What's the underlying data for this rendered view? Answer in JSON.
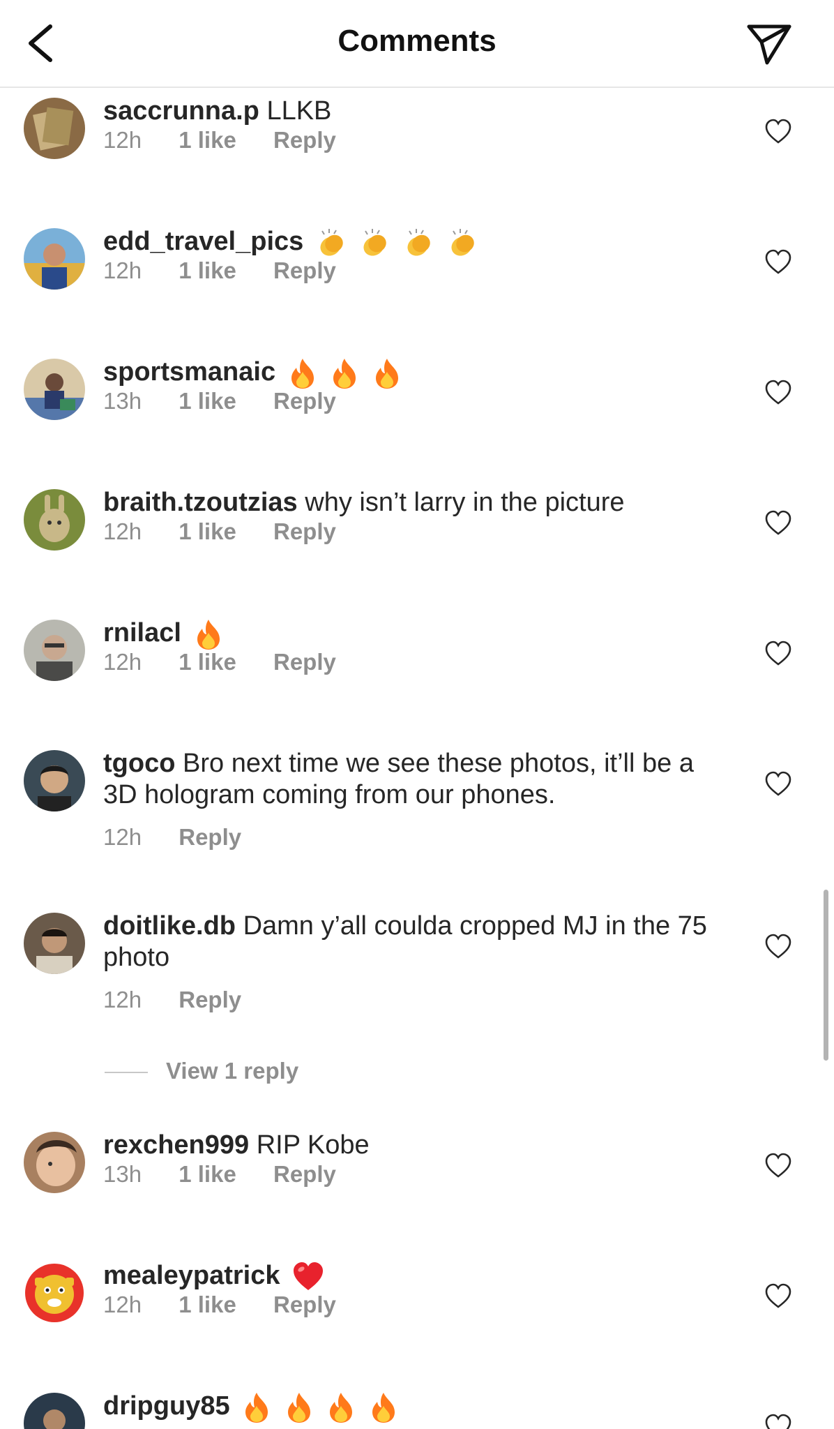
{
  "header": {
    "title": "Comments",
    "back_icon": "chevron-left-icon",
    "send_icon": "paper-plane-icon"
  },
  "comments": [
    {
      "username": "saccrunna.p",
      "text": "LLKB",
      "time": "12h",
      "likes": "1 like",
      "reply": "Reply",
      "emoji": "",
      "emoji_count": 0,
      "avatar_color": "#8a6a45"
    },
    {
      "username": "edd_travel_pics",
      "text": "",
      "time": "12h",
      "likes": "1 like",
      "reply": "Reply",
      "emoji": "clap",
      "emoji_count": 4,
      "avatar_color": "#e0b040"
    },
    {
      "username": "sportsmanaic",
      "text": "",
      "time": "13h",
      "likes": "1 like",
      "reply": "Reply",
      "emoji": "fire",
      "emoji_count": 3,
      "avatar_color": "#5577aa"
    },
    {
      "username": "braith.tzoutzias",
      "text": "why isn’t larry in the picture",
      "time": "12h",
      "likes": "1 like",
      "reply": "Reply",
      "emoji": "",
      "emoji_count": 0,
      "avatar_color": "#7a8c3c"
    },
    {
      "username": "rnilacl",
      "text": "",
      "time": "12h",
      "likes": "1 like",
      "reply": "Reply",
      "emoji": "fire",
      "emoji_count": 1,
      "avatar_color": "#8a8a80"
    },
    {
      "username": "tgoco",
      "text": "Bro next time we see these photos, it’ll be a 3D hologram coming from our phones.",
      "time": "12h",
      "likes": "",
      "reply": "Reply",
      "emoji": "",
      "emoji_count": 0,
      "avatar_color": "#3a4a55"
    },
    {
      "username": "doitlike.db",
      "text": "Damn y’all coulda cropped MJ in the 75 photo",
      "time": "12h",
      "likes": "",
      "reply": "Reply",
      "emoji": "",
      "emoji_count": 0,
      "avatar_color": "#5a4a3a"
    },
    {
      "username": "rexchen999",
      "text": "RIP Kobe",
      "time": "13h",
      "likes": "1 like",
      "reply": "Reply",
      "emoji": "",
      "emoji_count": 0,
      "avatar_color": "#c89a7a"
    },
    {
      "username": "mealeypatrick",
      "text": "",
      "time": "12h",
      "likes": "1 like",
      "reply": "Reply",
      "emoji": "heart",
      "emoji_count": 1,
      "avatar_color": "#f0c030"
    },
    {
      "username": "dripguy85",
      "text": "",
      "time": "",
      "likes": "",
      "reply": "",
      "emoji": "fire",
      "emoji_count": 4,
      "avatar_color": "#2a3a4a"
    }
  ],
  "view_replies": {
    "label": "View 1 reply"
  },
  "icons": {
    "like": "heart-outline-icon"
  },
  "colors": {
    "meta": "#8e8e8e",
    "text": "#262626",
    "fire": "#ff7a1a",
    "heart_emoji": "#e8222d",
    "clap": "#f7c23a"
  }
}
